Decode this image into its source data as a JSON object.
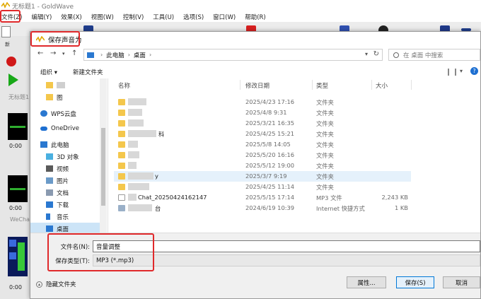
{
  "app": {
    "title": "无标题1 - GoldWave",
    "menu": [
      "文件(Z)",
      "编辑(Y)",
      "效果(X)",
      "视图(W)",
      "控制(V)",
      "工具(U)",
      "选项(S)",
      "窗口(W)",
      "帮助(R)"
    ],
    "new_label": "新",
    "doc1_title": "无标题1",
    "doc2_title": "WeCha",
    "times": [
      "0:00",
      "0:00",
      "0:00"
    ]
  },
  "dialog": {
    "title": "保存声音为",
    "breadcrumb": [
      "此电脑",
      "桌面"
    ],
    "search_placeholder": "在 桌面 中搜索",
    "organize": "组织 ▾",
    "new_folder": "新建文件夹",
    "help_glyph": "?",
    "nav_items": [
      {
        "label": "",
        "icon": "folder-icon"
      },
      {
        "label": "图",
        "icon": "folder-icon"
      },
      {
        "label": "WPS云盘",
        "icon": "wps-cloud-icon"
      },
      {
        "label": "OneDrive",
        "icon": "onedrive-icon"
      },
      {
        "label": "此电脑",
        "icon": "pc-icon"
      },
      {
        "label": "3D 对象",
        "icon": "3d-objects-icon"
      },
      {
        "label": "视频",
        "icon": "video-icon"
      },
      {
        "label": "图片",
        "icon": "pictures-icon"
      },
      {
        "label": "文档",
        "icon": "documents-icon"
      },
      {
        "label": "下载",
        "icon": "downloads-icon"
      },
      {
        "label": "音乐",
        "icon": "music-icon"
      },
      {
        "label": "桌面",
        "icon": "desktop-icon"
      }
    ],
    "columns": {
      "name": "名称",
      "modified": "修改日期",
      "type": "类型",
      "size": "大小"
    },
    "files": [
      {
        "name": "",
        "date": "2025/4/23 17:16",
        "type": "文件夹",
        "size": ""
      },
      {
        "name": "",
        "date": "2025/4/8 9:31",
        "type": "文件夹",
        "size": ""
      },
      {
        "name": "",
        "date": "2025/3/21 16:35",
        "type": "文件夹",
        "size": ""
      },
      {
        "name": "科",
        "date": "2025/4/25 15:21",
        "type": "文件夹",
        "size": ""
      },
      {
        "name": "",
        "date": "2025/5/8 14:05",
        "type": "文件夹",
        "size": ""
      },
      {
        "name": "",
        "date": "2025/5/20 16:16",
        "type": "文件夹",
        "size": ""
      },
      {
        "name": "",
        "date": "2025/5/12 19:00",
        "type": "文件夹",
        "size": ""
      },
      {
        "name": "y",
        "date": "2025/3/7 9:19",
        "type": "文件夹",
        "size": ""
      },
      {
        "name": "",
        "date": "2025/4/25 11:14",
        "type": "文件夹",
        "size": ""
      },
      {
        "name": "Chat_20250424162147",
        "date": "2025/5/15 17:14",
        "type": "MP3 文件",
        "size": "2,243 KB"
      },
      {
        "name": "台",
        "date": "2024/6/19 10:39",
        "type": "Internet 快捷方式",
        "size": "1 KB"
      }
    ],
    "filename_label": "文件名(N):",
    "filename_value": "音量调整",
    "filetype_label": "保存类型(T):",
    "filetype_value": "MP3 (*.mp3)",
    "hide_folders": "隐藏文件夹",
    "btn_properties": "属性...",
    "btn_save": "保存(S)",
    "btn_cancel": "取消"
  },
  "colors": {
    "annotation": "#e0292b",
    "accent": "#0078d7",
    "folder": "#f4c74c"
  }
}
